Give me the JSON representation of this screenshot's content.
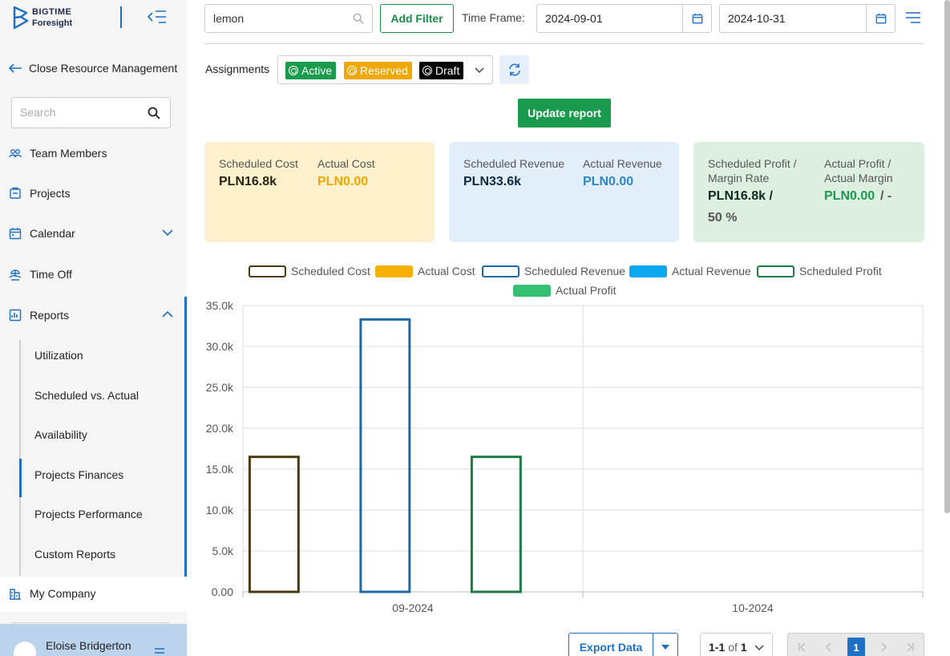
{
  "brand": {
    "line1": "BIGTIME",
    "line2": "Foresight",
    "primary": "#1f6fc4"
  },
  "sidebar": {
    "back_label": "Close Resource Management",
    "search_placeholder": "Search",
    "items": {
      "team": "Team Members",
      "projects": "Projects",
      "calendar": "Calendar",
      "timeoff": "Time Off",
      "reports": "Reports",
      "mycompany": "My Company"
    },
    "reports_sub": [
      "Utilization",
      "Scheduled vs. Actual",
      "Availability",
      "Projects Finances",
      "Projects Performance",
      "Custom Reports"
    ],
    "active_sub": "Projects Finances",
    "user_name": "Eloise Bridgerton"
  },
  "toolbar": {
    "search_value": "lemon",
    "add_filter": "Add Filter",
    "timeframe_label": "Time Frame:",
    "date_from": "2024-09-01",
    "date_to": "2024-10-31"
  },
  "assignments": {
    "label": "Assignments",
    "chips": [
      {
        "label": "Active",
        "color": "#1a9a4c"
      },
      {
        "label": "Reserved",
        "color": "#f0a800"
      },
      {
        "label": "Draft",
        "color": "#000000"
      }
    ]
  },
  "update_report": "Update report",
  "cards": {
    "cost": {
      "sched_label": "Scheduled Cost",
      "sched_value": "PLN16.8k",
      "actual_label": "Actual Cost",
      "actual_value": "PLN0.00"
    },
    "revenue": {
      "sched_label": "Scheduled Revenue",
      "sched_value": "PLN33.6k",
      "actual_label": "Actual Revenue",
      "actual_value": "PLN0.00"
    },
    "profit": {
      "sched_label_1": "Scheduled Profit /",
      "sched_label_2": "Margin Rate",
      "sched_value_1": "PLN16.8k /",
      "sched_value_2": "50 %",
      "actual_label_1": "Actual Profit /",
      "actual_label_2": "Actual Margin",
      "actual_value": "PLN0.00",
      "actual_margin": "/ -"
    }
  },
  "chart_data": {
    "type": "bar",
    "categories": [
      "09-2024",
      "10-2024"
    ],
    "ylim": [
      0,
      35000
    ],
    "yticks": [
      "0.00",
      "5.0k",
      "10.0k",
      "15.0k",
      "20.0k",
      "25.0k",
      "30.0k",
      "35.0k"
    ],
    "series": [
      {
        "name": "Scheduled Cost",
        "values": [
          16500,
          0
        ],
        "color": "#4a3a10",
        "fill": false
      },
      {
        "name": "Actual Cost",
        "values": [
          0,
          0
        ],
        "color": "#f5b000",
        "fill": true
      },
      {
        "name": "Scheduled Revenue",
        "values": [
          33300,
          0
        ],
        "color": "#1c69a8",
        "fill": false
      },
      {
        "name": "Actual Revenue",
        "values": [
          0,
          0
        ],
        "color": "#0aa8f0",
        "fill": true
      },
      {
        "name": "Scheduled Profit",
        "values": [
          16500,
          0
        ],
        "color": "#1d7a45",
        "fill": false
      },
      {
        "name": "Actual Profit",
        "values": [
          0,
          0
        ],
        "color": "#36c072",
        "fill": true
      }
    ],
    "grid": true,
    "legend": "top"
  },
  "bottom": {
    "export_label": "Export Data",
    "page_range": "1-1",
    "page_of": "of",
    "page_total": "1",
    "current_page": "1"
  }
}
